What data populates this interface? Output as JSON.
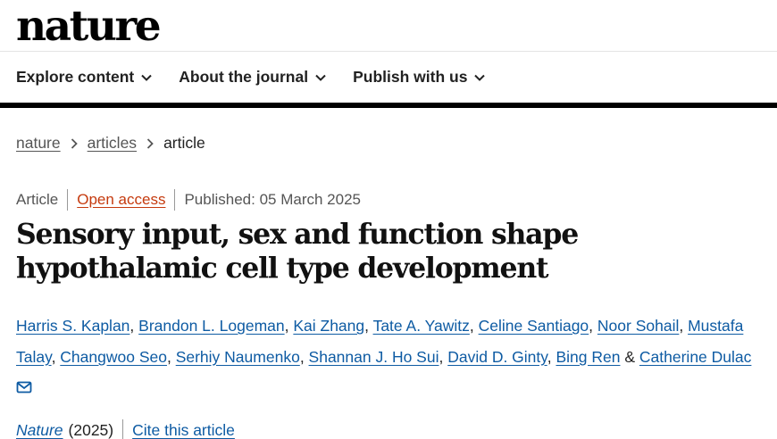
{
  "site": {
    "logo": "nature"
  },
  "nav": {
    "items": [
      {
        "label": "Explore content"
      },
      {
        "label": "About the journal"
      },
      {
        "label": "Publish with us"
      }
    ]
  },
  "breadcrumb": {
    "items": [
      {
        "label": "nature"
      },
      {
        "label": "articles"
      }
    ],
    "current": "article"
  },
  "meta": {
    "type": "Article",
    "access": "Open access",
    "published": "Published: 05 March 2025"
  },
  "article": {
    "title_line1": "Sensory input, sex and function shape",
    "title_line2": "hypothalamic cell type development"
  },
  "authors": [
    "Harris S. Kaplan",
    "Brandon L. Logeman",
    "Kai Zhang",
    "Tate A. Yawitz",
    "Celine Santiago",
    "Noor Sohail",
    "Mustafa Talay",
    "Changwoo Seo",
    "Serhiy Naumenko",
    "Shannan J. Ho Sui",
    "David D. Ginty",
    "Bing Ren",
    "Catherine Dulac"
  ],
  "authors_conjunction": "&",
  "icons": {
    "chevron": "chevron-down-icon",
    "separator": "chevron-right-icon",
    "email": "mail-icon"
  },
  "citation": {
    "journal": "Nature",
    "year": "(2025)",
    "cite_label": "Cite this article"
  },
  "colors": {
    "link": "#0e5ba3",
    "open_access": "#c53a0e",
    "rule": "#000000"
  }
}
